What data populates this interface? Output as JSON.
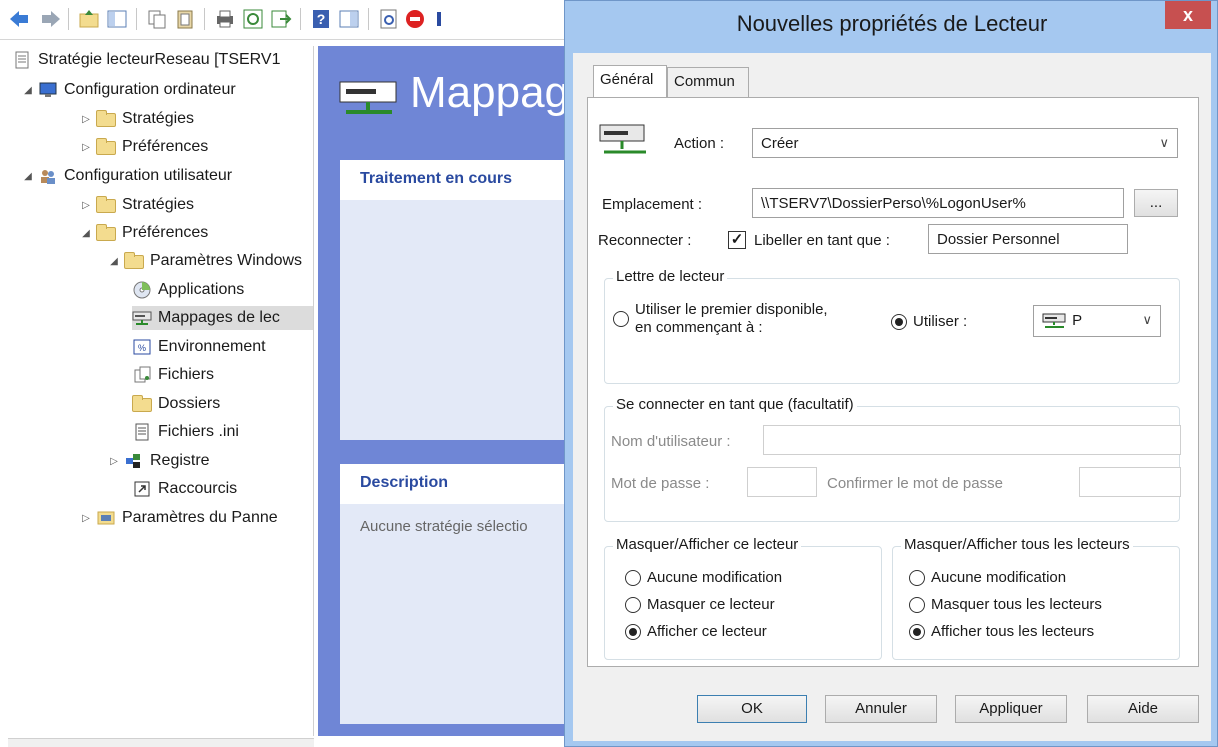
{
  "tree": {
    "root": "Stratégie lecteurReseau [TSERV1",
    "nodes": [
      {
        "label": "Configuration ordinateur"
      },
      {
        "label": "Stratégies"
      },
      {
        "label": "Préférences"
      },
      {
        "label": "Configuration utilisateur"
      },
      {
        "label": "Stratégies"
      },
      {
        "label": "Préférences"
      },
      {
        "label": "Paramètres Windows"
      },
      {
        "label": "Applications"
      },
      {
        "label": "Mappages de lec"
      },
      {
        "label": "Environnement"
      },
      {
        "label": "Fichiers"
      },
      {
        "label": "Dossiers"
      },
      {
        "label": "Fichiers .ini"
      },
      {
        "label": "Registre"
      },
      {
        "label": "Raccourcis"
      },
      {
        "label": "Paramètres du Panne"
      }
    ]
  },
  "content": {
    "title": "Mappag",
    "processing_header": "Traitement en cours",
    "description_header": "Description",
    "description_text": "Aucune stratégie sélectio"
  },
  "dialog": {
    "title": "Nouvelles propriétés de Lecteur",
    "close_label": "x",
    "tabs": [
      "Général",
      "Commun"
    ],
    "action_label": "Action :",
    "action_value": "Créer",
    "location_label": "Emplacement :",
    "location_value": "\\\\TSERV7\\DossierPerso\\%LogonUser%",
    "browse_label": "...",
    "reconnect_label": "Reconnecter :",
    "label_as_label": "Libeller en tant que :",
    "label_as_value": "Dossier Personnel",
    "drive_letter": {
      "title": "Lettre de lecteur",
      "first_available_line1": "Utiliser le premier disponible,",
      "first_available_line2": "en commençant à :",
      "use_label": "Utiliser :",
      "letter_value": "P"
    },
    "connect_as": {
      "title": "Se connecter en tant que (facultatif)",
      "username_label": "Nom d'utilisateur :",
      "password_label": "Mot de passe :",
      "confirm_label": "Confirmer le mot de passe"
    },
    "hide_show_this": {
      "title": "Masquer/Afficher ce lecteur",
      "options": [
        "Aucune modification",
        "Masquer ce lecteur",
        "Afficher ce lecteur"
      ],
      "selected": 2
    },
    "hide_show_all": {
      "title": "Masquer/Afficher tous les lecteurs",
      "options": [
        "Aucune modification",
        "Masquer tous les lecteurs",
        "Afficher tous les lecteurs"
      ],
      "selected": 2
    },
    "buttons": {
      "ok": "OK",
      "cancel": "Annuler",
      "apply": "Appliquer",
      "help": "Aide"
    }
  },
  "colors": {
    "content_bg": "#6f86d6",
    "dialog_frame": "#a5c8f0",
    "panel_head_text": "#2a4aa0"
  }
}
